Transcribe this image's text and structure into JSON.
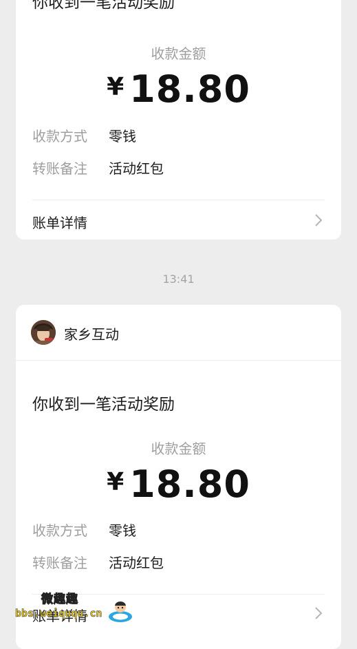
{
  "card1": {
    "title": "你收到一笔活动奖励",
    "amount_label": "收款金额",
    "currency": "¥",
    "amount": "18.80",
    "method_label": "收款方式",
    "method_value": "零钱",
    "note_label": "转账备注",
    "note_value": "活动红包",
    "detail_link": "账单详情"
  },
  "timestamp": "13:41",
  "card2": {
    "sender_name": "家乡互动",
    "title": "你收到一笔活动奖励",
    "amount_label": "收款金额",
    "currency": "¥",
    "amount": "18.80",
    "method_label": "收款方式",
    "method_value": "零钱",
    "note_label": "转账备注",
    "note_value": "活动红包",
    "detail_link": "账单详情"
  },
  "watermark": {
    "name": "微趣趣",
    "url": "bbs.weiququ.cn"
  }
}
